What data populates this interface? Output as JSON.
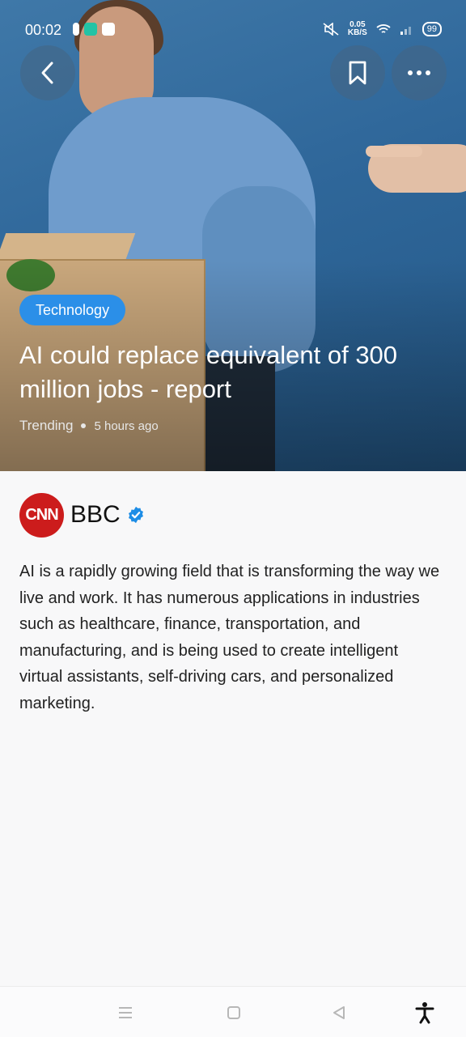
{
  "status": {
    "time": "00:02",
    "speed_value": "0.05",
    "speed_unit": "KB/S",
    "battery": "99"
  },
  "header": {
    "tag": "Technology",
    "headline": "AI could replace equivalent of 300 million jobs - report",
    "meta_label": "Trending",
    "meta_time": "5 hours ago"
  },
  "source": {
    "logo_text": "CNN",
    "name": "BBC"
  },
  "article": {
    "body": "AI is a rapidly growing field that is transforming the way we live and work. It has numerous applications in industries such as healthcare, finance, transportation, and manufacturing, and is being used to create intelligent virtual assistants, self-driving cars, and personalized marketing."
  },
  "colors": {
    "accent": "#2b8fe8",
    "logo_red": "#cc1c1c",
    "verified": "#1d8de6"
  }
}
